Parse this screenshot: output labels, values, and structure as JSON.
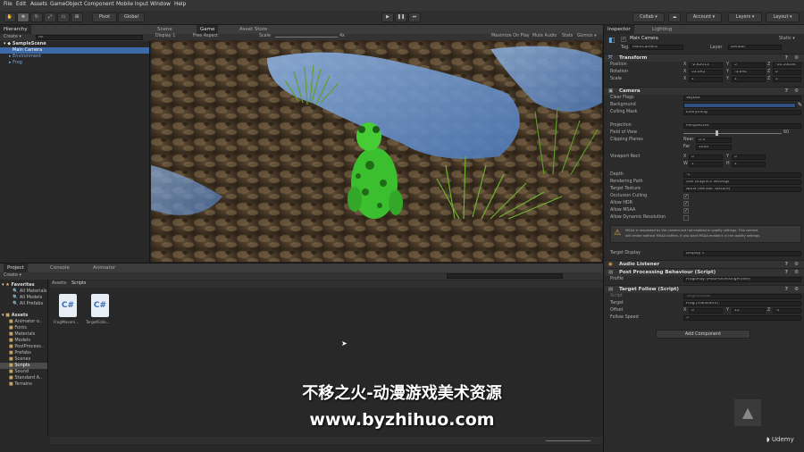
{
  "menu": [
    "File",
    "Edit",
    "Assets",
    "GameObject",
    "Component",
    "Mobile Input",
    "Window",
    "Help"
  ],
  "toolbar": {
    "pivot": "Pivot",
    "global": "Global",
    "collab": "Collab ▾",
    "account": "Account ▾",
    "layers": "Layers ▾",
    "layout": "Layout ▾"
  },
  "hierarchy": {
    "tab": "Hierarchy",
    "create": "Create ▾",
    "search": "All",
    "scene": "SampleScene",
    "items": [
      "Main Camera",
      "Environment",
      "Frog"
    ]
  },
  "center_tabs": [
    "Scene",
    "Game",
    "Asset Store"
  ],
  "game_bar": {
    "display": "Display 1",
    "aspect": "Free Aspect",
    "scale_label": "Scale",
    "scale_value": "4x",
    "maximize": "Maximize On Play",
    "mute": "Mute Audio",
    "stats": "Stats",
    "gizmos": "Gizmos ▾"
  },
  "project": {
    "tabs": [
      "Project",
      "Console",
      "Animator"
    ],
    "create": "Create ▾",
    "favorites": "Favorites",
    "fav_items": [
      "All Materials",
      "All Models",
      "All Prefabs"
    ],
    "assets_root": "Assets",
    "asset_folders": [
      "Animator o..",
      "Fonts",
      "Materials",
      "Models",
      "PostProcess..",
      "Prefabs",
      "Scenes",
      "Scripts",
      "Sound",
      "Standard A..",
      "Terrains"
    ],
    "breadcrumb": [
      "Assets",
      "Scripts"
    ],
    "files": [
      {
        "icon": "C#",
        "name": "FrogMovem..."
      },
      {
        "icon": "C#",
        "name": "TargetFollo..."
      }
    ]
  },
  "inspector": {
    "tabs": [
      "Inspector",
      "Lighting"
    ],
    "object_name": "Main Camera",
    "static": "Static ▾",
    "tag_label": "Tag",
    "tag_value": "MainCamera",
    "layer_label": "Layer",
    "layer_value": "Default",
    "transform": {
      "title": "Transform",
      "rows": [
        {
          "label": "Position",
          "x": "-2.82013",
          "y": "5",
          "z": "-10.50634"
        },
        {
          "label": "Rotation",
          "x": "53.695",
          "y": "-3.691",
          "z": "0"
        },
        {
          "label": "Scale",
          "x": "1",
          "y": "1",
          "z": "1"
        }
      ]
    },
    "camera": {
      "title": "Camera",
      "clear_flags": {
        "label": "Clear Flags",
        "value": "Skybox"
      },
      "background": {
        "label": "Background"
      },
      "culling": {
        "label": "Culling Mask",
        "value": "Everything"
      },
      "projection": {
        "label": "Projection",
        "value": "Perspective"
      },
      "fov": {
        "label": "Field of View",
        "value": "60"
      },
      "clipping": {
        "label": "Clipping Planes",
        "near_label": "Near",
        "near": "0.3",
        "far_label": "Far",
        "far": "1000"
      },
      "viewport": {
        "label": "Viewport Rect",
        "x": "0",
        "y": "0",
        "w": "1",
        "h": "1"
      },
      "depth": {
        "label": "Depth",
        "value": "-1"
      },
      "render_path": {
        "label": "Rendering Path",
        "value": "Use Graphics Settings"
      },
      "target_texture": {
        "label": "Target Texture",
        "value": "None (Render Texture)"
      },
      "occlusion": "Occlusion Culling",
      "hdr": "Allow HDR",
      "msaa": "Allow MSAA",
      "dyn_res": "Allow Dynamic Resolution",
      "warning_line1": "MSAA is requested by the camera but not enabled in quality settings. This camera",
      "warning_line2": "will render without MSAA buffers. If you want MSAA enable it in the quality settings.",
      "target_display": {
        "label": "Target Display",
        "value": "Display 1"
      }
    },
    "audio_listener": "Audio Listener",
    "ppb": {
      "title": "Post Processing Behaviour (Script)",
      "profile_label": "Profile",
      "profile_value": "FrogsPlay (PostProcessingProfile)"
    },
    "target_follow": {
      "title": "Target Follow (Script)",
      "script_label": "Script",
      "script_value": "TargetFollow",
      "target_label": "Target",
      "target_value": "Frog (Transform)",
      "offset_label": "Offset",
      "offset": {
        "x": "0",
        "y": "15",
        "z": "-5"
      },
      "speed_label": "Follow Speed",
      "speed_value": "5"
    },
    "add_component": "Add Component"
  },
  "watermark": {
    "line1": "不移之火-动漫游戏美术资源",
    "line2": "www.byzhihuo.com",
    "brand": "Udemy"
  },
  "colors": {
    "accent": "#3d6aa8",
    "checkmark": "#e0e0e0",
    "frog": "#3bbf2f",
    "water": "#6f9ad0"
  }
}
